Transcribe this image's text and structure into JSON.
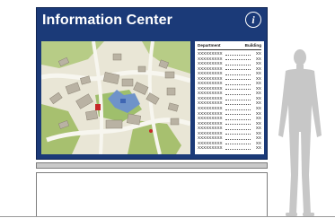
{
  "sign": {
    "title": "Information Center",
    "info_icon": "i",
    "colors": {
      "panel": "#1b3a78",
      "map_ground": "#e9e6d6",
      "map_grass": "#a7c06f",
      "map_roads": "#f7f6ef",
      "buildings": "#b9b2a3",
      "accent_red": "#c62828",
      "accent_blue": "#3f66b3"
    }
  },
  "directory": {
    "header_department": "Department",
    "header_building": "Building",
    "rows": [
      {
        "dept": "XXXXXXXXX",
        "bldg": "XX"
      },
      {
        "dept": "XXXXXXXXX",
        "bldg": "XX"
      },
      {
        "dept": "XXXXXXXXX",
        "bldg": "XX"
      },
      {
        "dept": "XXXXXXXXX",
        "bldg": "XX"
      },
      {
        "dept": "XXXXXXXXX",
        "bldg": "XX"
      },
      {
        "dept": "XXXXXXXXX",
        "bldg": "XX"
      },
      {
        "dept": "XXXXXXXXX",
        "bldg": "XX"
      },
      {
        "dept": "XXXXXXXXX",
        "bldg": "XX"
      },
      {
        "dept": "XXXXXXXXX",
        "bldg": "XX"
      },
      {
        "dept": "XXXXXXXXX",
        "bldg": "XX"
      },
      {
        "dept": "XXXXXXXXX",
        "bldg": "XX"
      },
      {
        "dept": "XXXXXXXXX",
        "bldg": "XX"
      },
      {
        "dept": "XXXXXXXXX",
        "bldg": "XX"
      },
      {
        "dept": "XXXXXXXXX",
        "bldg": "XX"
      },
      {
        "dept": "XXXXXXXXX",
        "bldg": "XX"
      },
      {
        "dept": "XXXXXXXXX",
        "bldg": "XX"
      },
      {
        "dept": "XXXXXXXXX",
        "bldg": "XX"
      },
      {
        "dept": "XXXXXXXXX",
        "bldg": "XX"
      },
      {
        "dept": "XXXXXXXXX",
        "bldg": "XX"
      },
      {
        "dept": "XXXXXXXXX",
        "bldg": "XX"
      }
    ]
  },
  "figure": {
    "icon": "person-silhouette-icon",
    "color": "#c7c7c7"
  }
}
